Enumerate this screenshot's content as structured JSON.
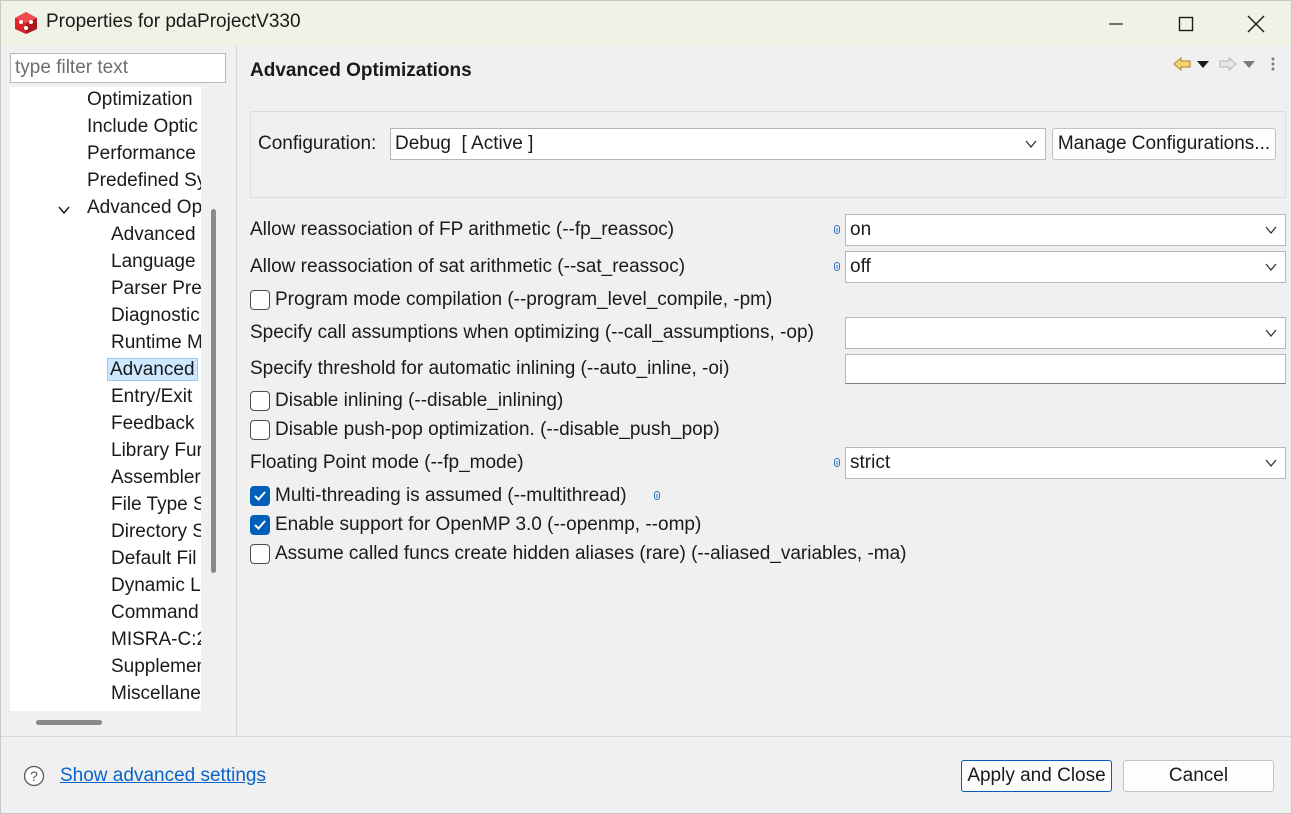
{
  "window": {
    "title": "Properties for pdaProjectV330"
  },
  "filter": {
    "placeholder": "type filter text"
  },
  "tree": {
    "items": [
      {
        "label": "Optimization"
      },
      {
        "label": "Include Optic"
      },
      {
        "label": "Performance"
      },
      {
        "label": "Predefined Sy"
      },
      {
        "label": "Advanced Op"
      },
      {
        "label": "Advanced"
      },
      {
        "label": "Language"
      },
      {
        "label": "Parser Prep"
      },
      {
        "label": "Diagnostic"
      },
      {
        "label": "Runtime M"
      },
      {
        "label": "Advanced"
      },
      {
        "label": "Entry/Exit"
      },
      {
        "label": "Feedback"
      },
      {
        "label": "Library Fur"
      },
      {
        "label": "Assembler"
      },
      {
        "label": "File Type S"
      },
      {
        "label": "Directory S"
      },
      {
        "label": "Default Fil"
      },
      {
        "label": "Dynamic L"
      },
      {
        "label": "Command"
      },
      {
        "label": "MISRA-C:2"
      },
      {
        "label": "Supplemen"
      },
      {
        "label": "Miscellane"
      }
    ]
  },
  "page": {
    "title": "Advanced Optimizations",
    "configuration_label": "Configuration:",
    "configuration_value": "Debug  [ Active ]",
    "manage_button": "Manage Configurations...",
    "options": {
      "fp_reassoc": {
        "label": "Allow reassociation of FP arithmetic (--fp_reassoc)",
        "value": "on"
      },
      "sat_reassoc": {
        "label": "Allow reassociation of sat arithmetic (--sat_reassoc)",
        "value": "off"
      },
      "program_level": {
        "label": "Program mode compilation (--program_level_compile, -pm)",
        "checked": false
      },
      "call_assumptions": {
        "label": "Specify call assumptions when optimizing (--call_assumptions, -op)",
        "value": ""
      },
      "auto_inline": {
        "label": "Specify threshold for automatic inlining (--auto_inline, -oi)",
        "value": ""
      },
      "disable_inlining": {
        "label": "Disable inlining (--disable_inlining)",
        "checked": false
      },
      "disable_push_pop": {
        "label": "Disable push-pop optimization. (--disable_push_pop)",
        "checked": false
      },
      "fp_mode": {
        "label": "Floating Point mode (--fp_mode)",
        "value": "strict"
      },
      "multithread": {
        "label": "Multi-threading is assumed (--multithread)",
        "checked": true
      },
      "openmp": {
        "label": "Enable support for OpenMP 3.0 (--openmp, --omp)",
        "checked": true
      },
      "aliased": {
        "label": "Assume called funcs create hidden aliases (rare) (--aliased_variables, -ma)",
        "checked": false
      }
    }
  },
  "footer": {
    "advanced_link": "Show advanced settings",
    "apply_button": "Apply and Close",
    "cancel_button": "Cancel"
  },
  "colors": {
    "accent": "#005fb8",
    "link": "#0a63c9",
    "selection": "#cde8ff",
    "app_icon": "#d6262b"
  }
}
